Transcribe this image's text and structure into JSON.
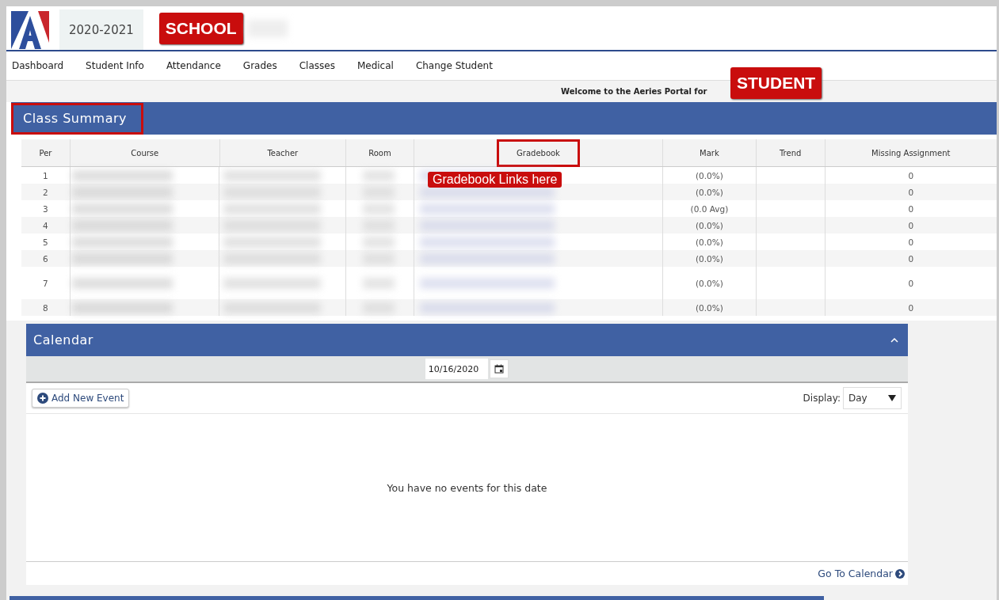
{
  "header": {
    "school_year": "2020-2021",
    "school_badge": "SCHOOL"
  },
  "nav": [
    {
      "label": "Dashboard"
    },
    {
      "label": "Student Info"
    },
    {
      "label": "Attendance"
    },
    {
      "label": "Grades"
    },
    {
      "label": "Classes"
    },
    {
      "label": "Medical"
    },
    {
      "label": "Change Student"
    }
  ],
  "welcome": {
    "text": "Welcome to the Aeries Portal for",
    "student_badge": "STUDENT"
  },
  "class_summary": {
    "title": "Class Summary",
    "title_highlighted": true,
    "callout": "Gradebook Links here",
    "columns": [
      {
        "label": "Per",
        "highlighted": false
      },
      {
        "label": "Course",
        "highlighted": false
      },
      {
        "label": "Teacher",
        "highlighted": false
      },
      {
        "label": "Room",
        "highlighted": false
      },
      {
        "label": "Gradebook",
        "highlighted": true
      },
      {
        "label": "Mark",
        "highlighted": false
      },
      {
        "label": "Trend",
        "highlighted": false
      },
      {
        "label": "Missing Assignment",
        "highlighted": false
      }
    ],
    "rows": [
      {
        "per": "1",
        "mark": "(0.0%)",
        "missing": "0",
        "tall": false
      },
      {
        "per": "2",
        "mark": "(0.0%)",
        "missing": "0",
        "tall": false
      },
      {
        "per": "3",
        "mark": "(0.0 Avg)",
        "missing": "0",
        "tall": false
      },
      {
        "per": "4",
        "mark": "(0.0%)",
        "missing": "0",
        "tall": false
      },
      {
        "per": "5",
        "mark": "(0.0%)",
        "missing": "0",
        "tall": false
      },
      {
        "per": "6",
        "mark": "(0.0%)",
        "missing": "0",
        "tall": false
      },
      {
        "per": "7",
        "mark": "(0.0%)",
        "missing": "0",
        "tall": true
      },
      {
        "per": "8",
        "mark": "(0.0%)",
        "missing": "0",
        "tall": false
      }
    ]
  },
  "calendar": {
    "title": "Calendar",
    "expanded": true,
    "date": "10/16/2020",
    "add_button": "Add New Event",
    "display_label": "Display:",
    "display_value": "Day",
    "empty_message": "You have no events for this date",
    "footer_link": "Go To Calendar"
  }
}
